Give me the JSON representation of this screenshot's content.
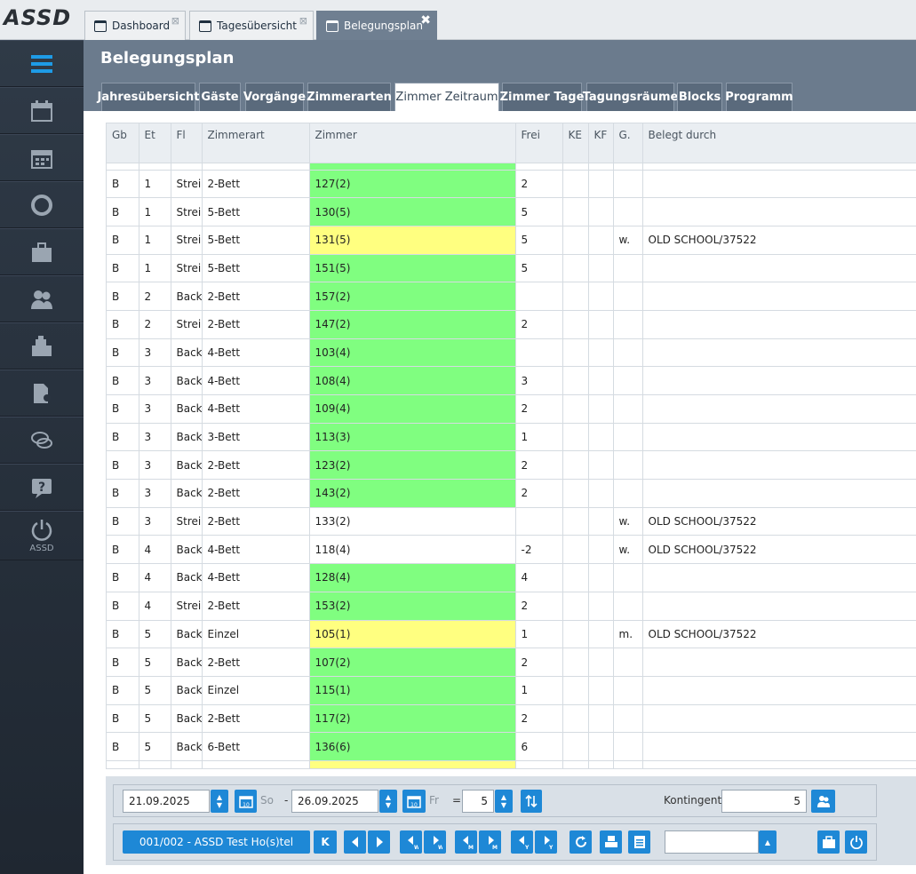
{
  "app": {
    "logo": "ASSD"
  },
  "top_tabs": [
    {
      "label": "Dashboard"
    },
    {
      "label": "Tagesübersicht"
    },
    {
      "label": "Belegungsplan"
    }
  ],
  "sidebar": {
    "items": [
      {
        "icon": "menu-icon"
      },
      {
        "icon": "calendar-icon"
      },
      {
        "icon": "calendar-grid-icon"
      },
      {
        "icon": "ring-icon"
      },
      {
        "icon": "suitcase-icon"
      },
      {
        "icon": "users-icon"
      },
      {
        "icon": "cash-register-icon"
      },
      {
        "icon": "document-icon"
      },
      {
        "icon": "chat-icon"
      },
      {
        "icon": "help-icon"
      },
      {
        "icon": "power-icon",
        "label": "ASSD"
      }
    ]
  },
  "page": {
    "title": "Belegungsplan"
  },
  "sub_tabs": [
    "Jahresübersicht",
    "Gäste",
    "Vorgänge",
    "Zimmerarten",
    "Zimmer Zeitraum",
    "Zimmer Tage",
    "Tagungsräume",
    "Blocks",
    "Programm"
  ],
  "table": {
    "columns": [
      "Gb",
      "Et",
      "Fl",
      "Zimmerart",
      "Zimmer",
      "Frei",
      "KE",
      "KF",
      "G.",
      "Belegt durch"
    ],
    "rows": [
      [
        "B",
        "1",
        "Strei",
        "2-Bett",
        "127(2)",
        "2",
        "",
        "",
        "",
        "",
        "g"
      ],
      [
        "B",
        "1",
        "Strei",
        "5-Bett",
        "130(5)",
        "5",
        "",
        "",
        "",
        "",
        "g"
      ],
      [
        "B",
        "1",
        "Strei",
        "5-Bett",
        "131(5)",
        "5",
        "",
        "",
        "w.",
        "OLD SCHOOL/37522",
        "y"
      ],
      [
        "B",
        "1",
        "Strei",
        "5-Bett",
        "151(5)",
        "5",
        "",
        "",
        "",
        "",
        "g"
      ],
      [
        "B",
        "2",
        "Back",
        "2-Bett",
        "157(2)",
        "",
        "",
        "",
        "",
        "",
        "g"
      ],
      [
        "B",
        "2",
        "Strei",
        "2-Bett",
        "147(2)",
        "2",
        "",
        "",
        "",
        "",
        "g"
      ],
      [
        "B",
        "3",
        "Back",
        "4-Bett",
        "103(4)",
        "",
        "",
        "",
        "",
        "",
        "g"
      ],
      [
        "B",
        "3",
        "Back",
        "4-Bett",
        "108(4)",
        "3",
        "",
        "",
        "",
        "",
        "g"
      ],
      [
        "B",
        "3",
        "Back",
        "4-Bett",
        "109(4)",
        "2",
        "",
        "",
        "",
        "",
        "g"
      ],
      [
        "B",
        "3",
        "Back",
        "3-Bett",
        "113(3)",
        "1",
        "",
        "",
        "",
        "",
        "g"
      ],
      [
        "B",
        "3",
        "Back",
        "2-Bett",
        "123(2)",
        "2",
        "",
        "",
        "",
        "",
        "g"
      ],
      [
        "B",
        "3",
        "Back",
        "2-Bett",
        "143(2)",
        "2",
        "",
        "",
        "",
        "",
        "g"
      ],
      [
        "B",
        "3",
        "Strei",
        "2-Bett",
        "133(2)",
        "",
        "",
        "",
        "w.",
        "OLD SCHOOL/37522",
        "w"
      ],
      [
        "B",
        "4",
        "Back",
        "4-Bett",
        "118(4)",
        "-2",
        "",
        "",
        "w.",
        "OLD SCHOOL/37522",
        "w"
      ],
      [
        "B",
        "4",
        "Back",
        "4-Bett",
        "128(4)",
        "4",
        "",
        "",
        "",
        "",
        "g"
      ],
      [
        "B",
        "4",
        "Strei",
        "2-Bett",
        "153(2)",
        "2",
        "",
        "",
        "",
        "",
        "g"
      ],
      [
        "B",
        "5",
        "Back",
        "Einzel",
        "105(1)",
        "1",
        "",
        "",
        "m.",
        "OLD SCHOOL/37522",
        "y"
      ],
      [
        "B",
        "5",
        "Back",
        "2-Bett",
        "107(2)",
        "2",
        "",
        "",
        "",
        "",
        "g"
      ],
      [
        "B",
        "5",
        "Back",
        "Einzel",
        "115(1)",
        "1",
        "",
        "",
        "",
        "",
        "g"
      ],
      [
        "B",
        "5",
        "Back",
        "2-Bett",
        "117(2)",
        "2",
        "",
        "",
        "",
        "",
        "g"
      ],
      [
        "B",
        "5",
        "Back",
        "6-Bett",
        "136(6)",
        "6",
        "",
        "",
        "",
        "",
        "g"
      ]
    ]
  },
  "controls": {
    "date_from": "21.09.2025",
    "day_from": "So",
    "separator": "-",
    "date_to": "26.09.2025",
    "day_to": "Fr",
    "equals": "=",
    "days": "5",
    "kontingent_label": "Kontingent:",
    "kontingent_value": "5",
    "hotel_button": "001/002 - ASSD Test Ho(s)tel",
    "k_button": "K",
    "nav_buttons": [
      {
        "icon": "prev-icon"
      },
      {
        "icon": "next-icon"
      },
      {
        "icon": "prev-week-icon",
        "sub": "W"
      },
      {
        "icon": "next-week-icon",
        "sub": "W"
      },
      {
        "icon": "prev-month-icon",
        "sub": "M"
      },
      {
        "icon": "next-month-icon",
        "sub": "M"
      },
      {
        "icon": "prev-year-icon",
        "sub": "Y"
      },
      {
        "icon": "next-year-icon",
        "sub": "Y"
      }
    ],
    "select_value": ""
  },
  "colors": {
    "green": "#80fe80",
    "yellow": "#ffff80",
    "accent": "#1e88d6",
    "header": "#6b7b8d",
    "sidebar": "#2a3440"
  }
}
